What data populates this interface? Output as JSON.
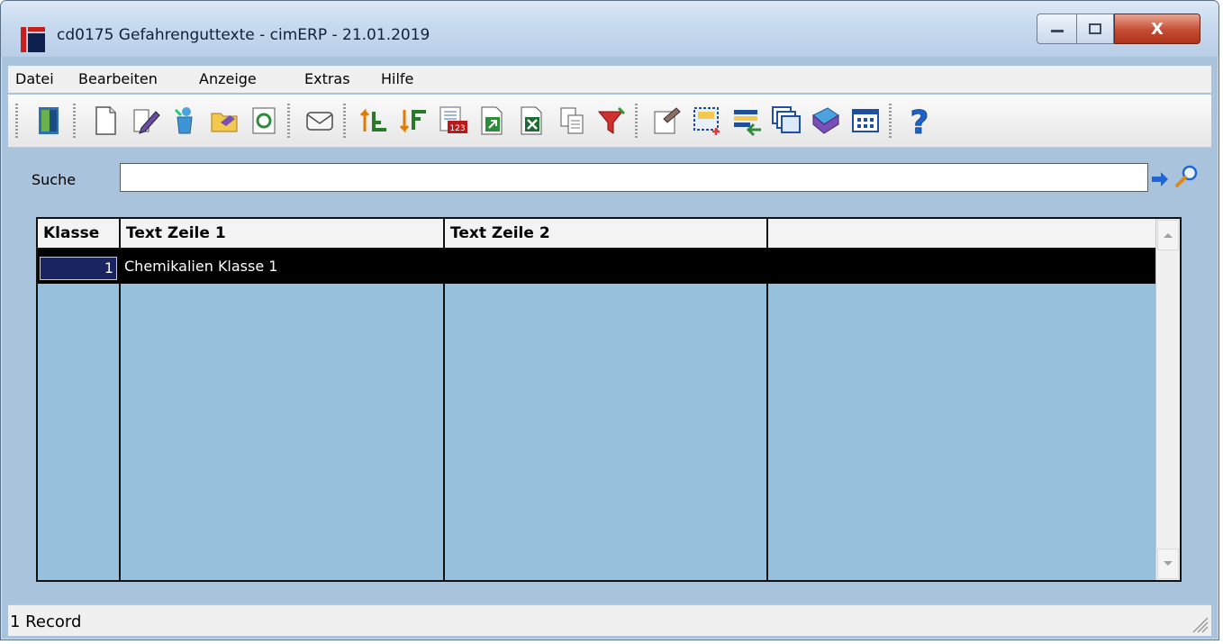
{
  "window": {
    "title": "cd0175 Gefahrenguttexte - cimERP - 21.01.2019",
    "controls": {
      "minimize": "–",
      "maximize": "□",
      "close": "X"
    }
  },
  "menu": [
    "Datei",
    "Bearbeiten",
    "Anzeige",
    "Extras",
    "Hilfe"
  ],
  "toolbar": {
    "buttons": [
      "exit-door",
      "new-document",
      "edit-pencil",
      "delete-recycle",
      "open-folder",
      "refresh",
      "email",
      "sort-ascending",
      "sort-descending",
      "number-format",
      "export",
      "export-excel",
      "copy",
      "filter",
      "properties",
      "select-area",
      "transfer",
      "windows",
      "book",
      "grid-view",
      "help"
    ]
  },
  "search": {
    "label": "Suche",
    "value": ""
  },
  "table": {
    "columns": [
      "Klasse",
      "Text Zeile 1",
      "Text Zeile 2",
      ""
    ],
    "rows": [
      {
        "klasse": "1",
        "text1": "Chemikalien Klasse 1",
        "text2": "",
        "extra": ""
      }
    ]
  },
  "status": {
    "text": "1 Record"
  },
  "colors": {
    "grid_bg": "#96c0dc",
    "window_bg": "#a9c3dc",
    "selected_row": "#000000"
  }
}
